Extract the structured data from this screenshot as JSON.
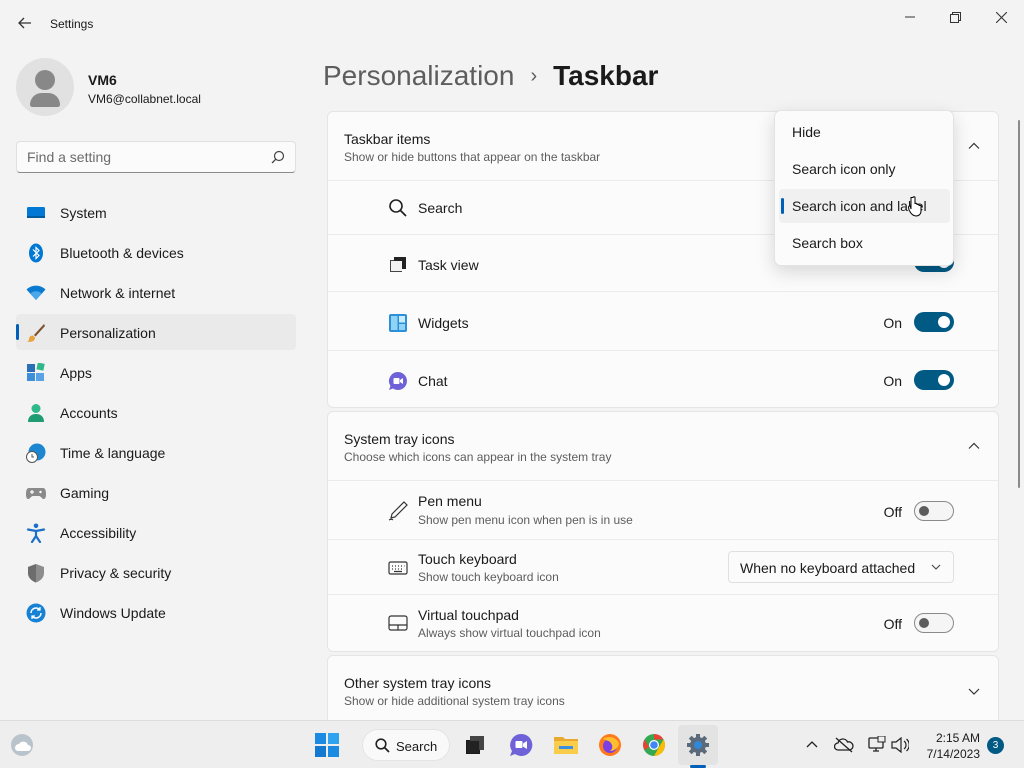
{
  "window": {
    "title": "Settings"
  },
  "profile": {
    "name": "VM6",
    "email": "VM6@collabnet.local"
  },
  "search": {
    "placeholder": "Find a setting"
  },
  "sidebar": {
    "items": [
      {
        "label": "System",
        "icon": "monitor-icon",
        "color": "#0078d4"
      },
      {
        "label": "Bluetooth & devices",
        "icon": "bluetooth-icon",
        "color": "#0078d4"
      },
      {
        "label": "Network & internet",
        "icon": "wifi-icon",
        "color": "#0a7ad0"
      },
      {
        "label": "Personalization",
        "icon": "brush-icon",
        "color": "#e8a33d",
        "active": true
      },
      {
        "label": "Apps",
        "icon": "apps-icon",
        "color": "#3c8fd8"
      },
      {
        "label": "Accounts",
        "icon": "person-icon",
        "color": "#2fb88a"
      },
      {
        "label": "Time & language",
        "icon": "globe-clock-icon",
        "color": "#1d86d1"
      },
      {
        "label": "Gaming",
        "icon": "controller-icon",
        "color": "#7a7a7a"
      },
      {
        "label": "Accessibility",
        "icon": "accessibility-icon",
        "color": "#1c6fc8"
      },
      {
        "label": "Privacy & security",
        "icon": "shield-icon",
        "color": "#7d7d7d"
      },
      {
        "label": "Windows Update",
        "icon": "update-icon",
        "color": "#1682d6"
      }
    ]
  },
  "breadcrumb": {
    "parent": "Personalization",
    "separator": "›",
    "current": "Taskbar"
  },
  "taskbar_items": {
    "title": "Taskbar items",
    "subtitle": "Show or hide buttons that appear on the taskbar",
    "rows": [
      {
        "label": "Search",
        "icon": "search-icon"
      },
      {
        "label": "Task view",
        "icon": "taskview-icon"
      },
      {
        "label": "Widgets",
        "icon": "widgets-icon",
        "state": "On"
      },
      {
        "label": "Chat",
        "icon": "chat-icon",
        "state": "On"
      }
    ]
  },
  "search_dropdown": {
    "options": [
      "Hide",
      "Search icon only",
      "Search icon and label",
      "Search box"
    ],
    "selected": "Search icon and label"
  },
  "system_tray": {
    "title": "System tray icons",
    "subtitle": "Choose which icons can appear in the system tray",
    "rows": [
      {
        "label": "Pen menu",
        "desc": "Show pen menu icon when pen is in use",
        "state": "Off",
        "icon": "pen-icon"
      },
      {
        "label": "Touch keyboard",
        "desc": "Show touch keyboard icon",
        "value": "When no keyboard attached",
        "icon": "keyboard-icon"
      },
      {
        "label": "Virtual touchpad",
        "desc": "Always show virtual touchpad icon",
        "state": "Off",
        "icon": "touchpad-icon"
      }
    ]
  },
  "other_tray": {
    "title": "Other system tray icons",
    "subtitle": "Show or hide additional system tray icons"
  },
  "taskbar": {
    "search_label": "Search",
    "time": "2:15 AM",
    "date": "7/14/2023",
    "notification_count": "3",
    "accent": "#005fb8"
  }
}
